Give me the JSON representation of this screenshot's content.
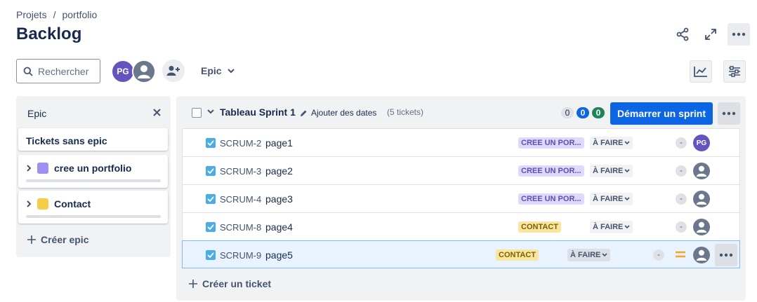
{
  "breadcrumb": [
    "Projets",
    "/",
    "portfolio"
  ],
  "page_title": "Backlog",
  "search": {
    "placeholder": "Rechercher"
  },
  "toolbar": {
    "avatar_initials": "PG",
    "epic_filter_label": "Epic"
  },
  "epic_panel": {
    "title": "Epic",
    "no_epic_label": "Tickets sans epic",
    "epics": [
      {
        "name": "cree un portfolio",
        "color": "#9f8fef"
      },
      {
        "name": "Contact",
        "color": "#f5cd47"
      }
    ],
    "create_label": "Créer epic"
  },
  "sprint": {
    "name": "Tableau Sprint 1",
    "add_dates_label": "Ajouter des dates",
    "ticket_count": "(5 tickets)",
    "counts": {
      "todo": "0",
      "in_progress": "0",
      "done": "0"
    },
    "start_label": "Démarrer un sprint",
    "issues": [
      {
        "key": "SCRUM-2",
        "summary": "page1",
        "epic": "CREE UN POR...",
        "status": "À FAIRE",
        "estimate": "-",
        "assignee": "PG"
      },
      {
        "key": "SCRUM-3",
        "summary": "page2",
        "epic": "CREE UN POR...",
        "status": "À FAIRE",
        "estimate": "-",
        "assignee": ""
      },
      {
        "key": "SCRUM-4",
        "summary": "page3",
        "epic": "CREE UN POR...",
        "status": "À FAIRE",
        "estimate": "-",
        "assignee": ""
      },
      {
        "key": "SCRUM-8",
        "summary": "page4",
        "epic": "CONTACT",
        "status": "À FAIRE",
        "estimate": "-",
        "assignee": ""
      },
      {
        "key": "SCRUM-9",
        "summary": "page5",
        "epic": "CONTACT",
        "status": "À FAIRE",
        "estimate": "-",
        "assignee": "",
        "priority": "medium-icon"
      }
    ],
    "create_issue_label": "Créer un ticket"
  },
  "colors": {
    "primary": "#0c66e4",
    "epic_purple_lozenge": "#dfd8fd",
    "epic_yellow_lozenge": "#f8e6a0",
    "priority_medium": "#f5a623",
    "selected_row": "#e9f2ff"
  }
}
